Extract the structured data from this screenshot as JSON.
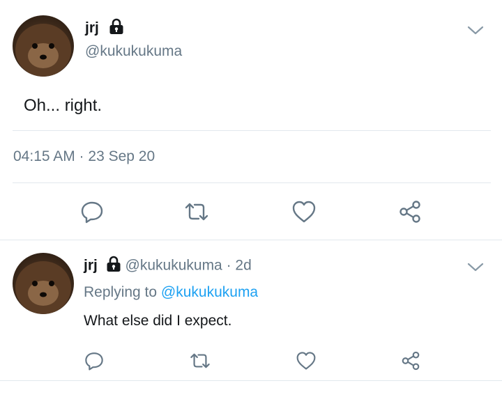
{
  "tweet": {
    "display_name": "jrj",
    "handle": "@kukukukuma",
    "text": "Oh... right.",
    "timestamp": "04:15 AM · 23 Sep 20",
    "actions": [
      "reply-icon",
      "retweet-icon",
      "like-icon",
      "share-icon"
    ],
    "menu_icon": "chevron-down-icon"
  },
  "reply": {
    "display_name": "jrj",
    "handle": "@kukukukuma",
    "age": "· 2d",
    "replying_prefix": "Replying to",
    "replying_handle": "@kukukukuma",
    "text": "What else did I expect.",
    "actions": [
      "reply-icon",
      "retweet-icon",
      "like-icon",
      "share-icon"
    ],
    "menu_icon": "chevron-down-icon"
  },
  "colors": {
    "muted": "#657786",
    "link": "#1da1f2",
    "divider": "#e1e8ed",
    "text": "#14171a"
  }
}
